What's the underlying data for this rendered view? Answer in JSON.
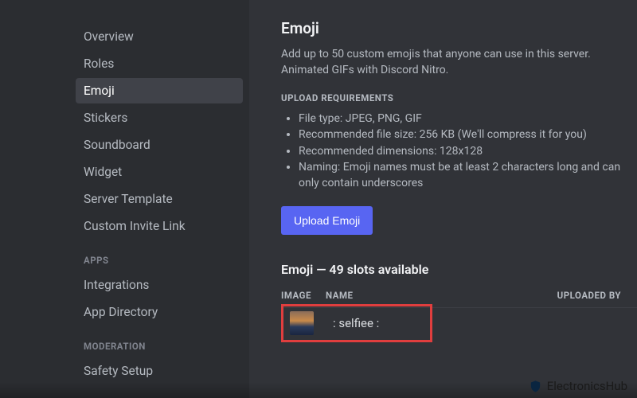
{
  "sidebar": {
    "items": [
      {
        "label": "Overview"
      },
      {
        "label": "Roles"
      },
      {
        "label": "Emoji"
      },
      {
        "label": "Stickers"
      },
      {
        "label": "Soundboard"
      },
      {
        "label": "Widget"
      },
      {
        "label": "Server Template"
      },
      {
        "label": "Custom Invite Link"
      }
    ],
    "section_apps": "APPS",
    "apps_items": [
      {
        "label": "Integrations"
      },
      {
        "label": "App Directory"
      }
    ],
    "section_moderation": "MODERATION",
    "moderation_items": [
      {
        "label": "Safety Setup"
      }
    ]
  },
  "page": {
    "title": "Emoji",
    "description": "Add up to 50 custom emojis that anyone can use in this server. Animated GIFs with Discord Nitro.",
    "requirements_header": "UPLOAD REQUIREMENTS",
    "requirements": [
      "File type: JPEG, PNG, GIF",
      "Recommended file size: 256 KB (We'll compress it for you)",
      "Recommended dimensions: 128x128",
      "Naming: Emoji names must be at least 2 characters long and can only contain underscores"
    ],
    "upload_button": "Upload Emoji",
    "slots_title": "Emoji — 49 slots available",
    "columns": {
      "image": "IMAGE",
      "name": "NAME",
      "uploaded_by": "UPLOADED BY"
    },
    "emoji_list": [
      {
        "name": ": selfiee :"
      }
    ]
  },
  "watermark": "ElectronicsHub"
}
